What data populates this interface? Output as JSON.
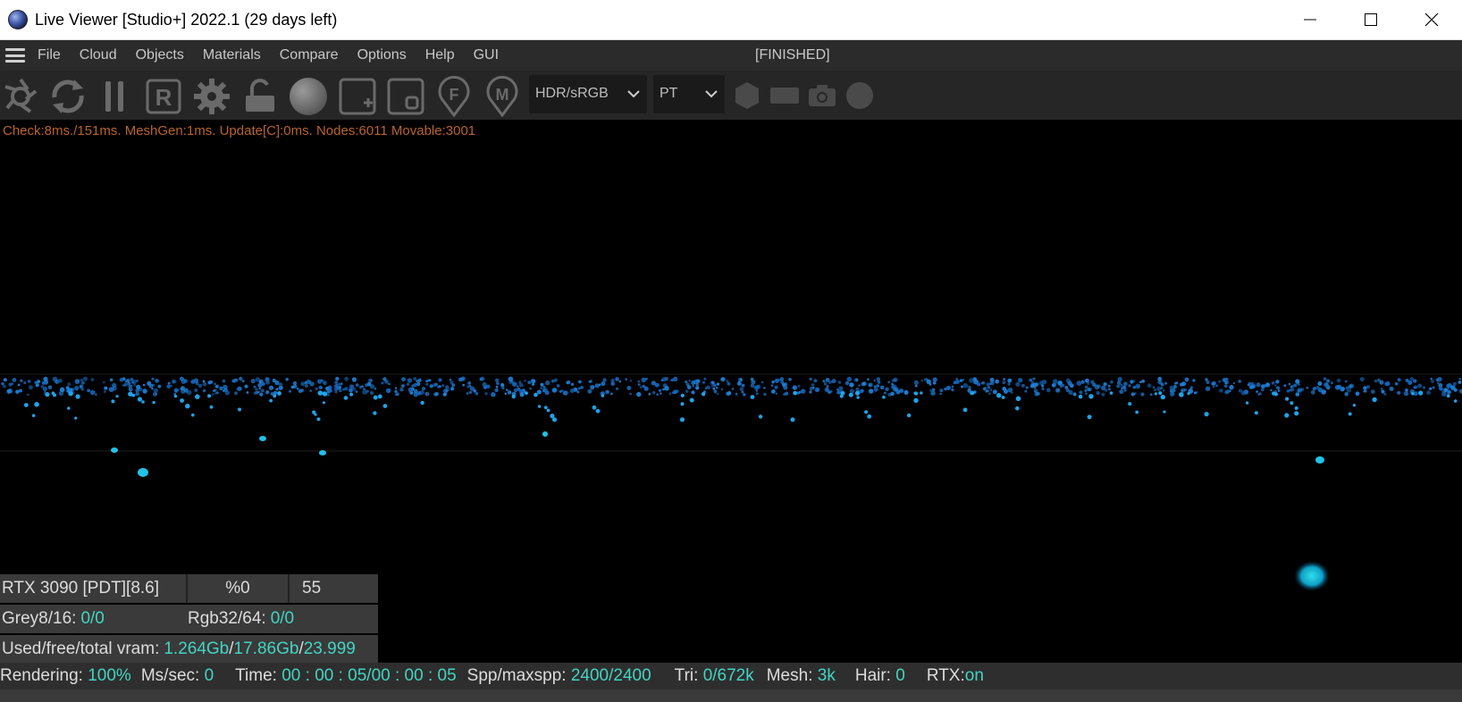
{
  "window": {
    "title": "Live Viewer [Studio+] 2022.1 (29 days left)"
  },
  "menu": {
    "items": [
      "File",
      "Cloud",
      "Objects",
      "Materials",
      "Compare",
      "Options",
      "Help",
      "GUI"
    ],
    "status": "[FINISHED]"
  },
  "toolbar": {
    "icons": [
      "aperture-icon",
      "refresh-icon",
      "pause-icon",
      "region-render-icon",
      "settings-gear-icon",
      "unlock-icon",
      "material-sphere-icon",
      "add-region-icon",
      "fit-region-icon",
      "focus-pick-icon",
      "material-pick-icon"
    ],
    "colorspace": "HDR/sRGB",
    "kernel": "PT",
    "extra_icons": [
      "hexagon-icon",
      "rectangle-icon",
      "camera-icon",
      "circle-icon"
    ]
  },
  "viewport": {
    "stats": "Check:8ms./151ms. MeshGen:1ms. Update[C]:0ms. Nodes:6011 Movable:3001"
  },
  "info": {
    "gpu": "RTX 3090 [PDT][8.6]",
    "percent": "%0",
    "count": "55",
    "grey_label": "Grey8/16: ",
    "grey_value": "0/0",
    "rgb_label": "Rgb32/64: ",
    "rgb_value": "0/0",
    "vram_label": "Used/free/total vram: ",
    "vram_used": "1.264Gb",
    "vram_sep1": "/",
    "vram_free": "17.86Gb",
    "vram_sep2": "/",
    "vram_total": "23.999"
  },
  "status": {
    "rendering_label": "Rendering: ",
    "rendering_value": "100%",
    "mssec_label": "Ms/sec: ",
    "mssec_value": "0",
    "time_label": "Time: ",
    "time_value": "00 : 00 : 05/00 : 00 : 05",
    "spp_label": "Spp/maxspp: ",
    "spp_value": "2400/2400",
    "tri_label": "Tri: ",
    "tri_value": "0/672k",
    "mesh_label": "Mesh: ",
    "mesh_value": "3k",
    "hair_label": "Hair: ",
    "hair_value": "0",
    "rtx_label": "RTX:",
    "rtx_value": "on"
  },
  "colors": {
    "accent_value": "#43d4c2",
    "stats_text": "#b8642c",
    "particle": "#1e90ff"
  }
}
